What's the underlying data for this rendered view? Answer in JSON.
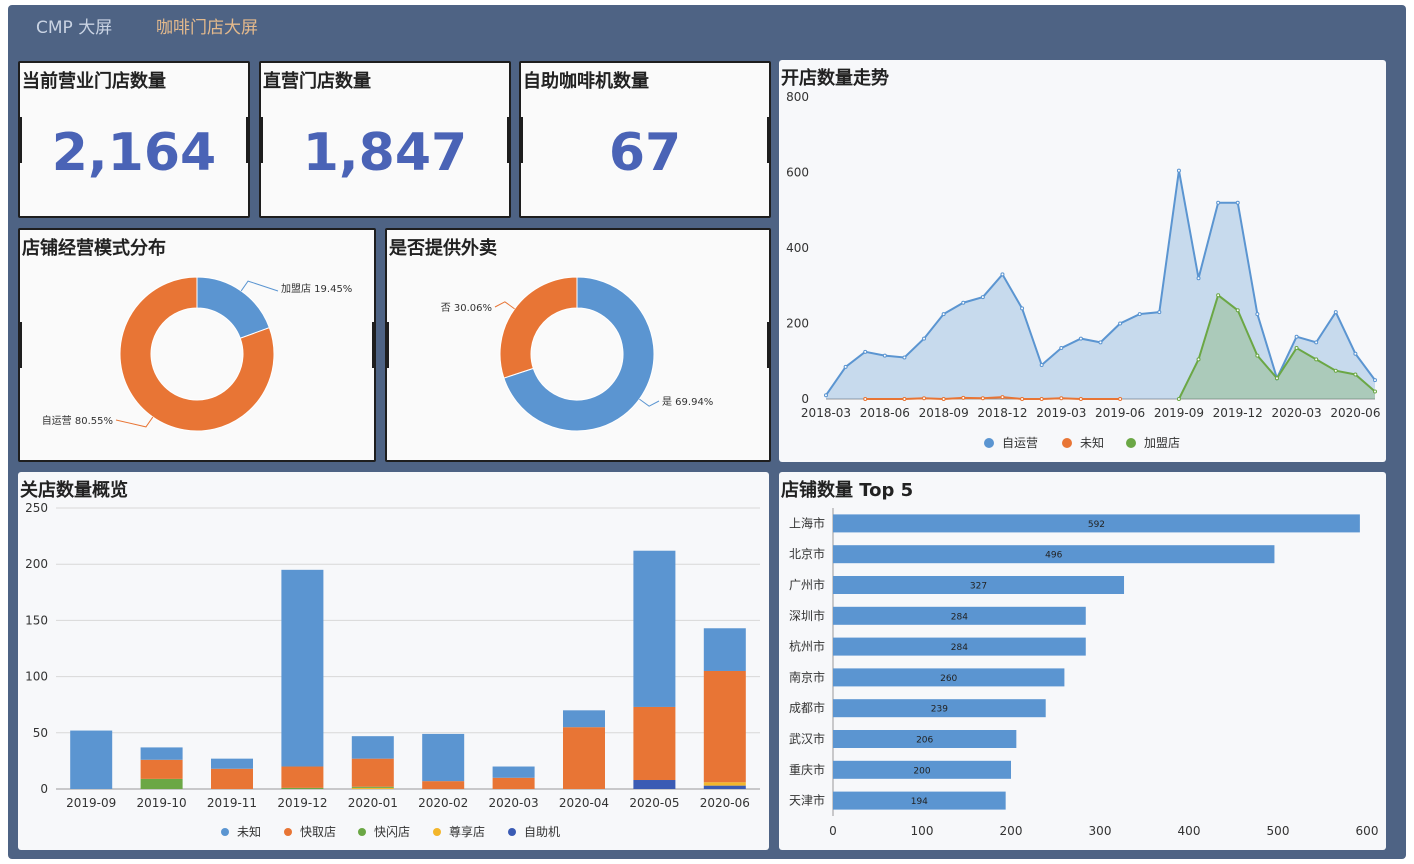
{
  "nav": {
    "cmp": "CMP 大屏",
    "coffee": "咖啡门店大屏"
  },
  "kpis": [
    {
      "title": "当前营业门店数量",
      "value": "2,164"
    },
    {
      "title": "直营门店数量",
      "value": "1,847"
    },
    {
      "title": "自助咖啡机数量",
      "value": "67"
    }
  ],
  "panels": {
    "mode": "店铺经营模式分布",
    "delivery": "是否提供外卖",
    "trend": "开店数量走势",
    "close": "关店数量概览",
    "top": "店铺数量 Top 5"
  },
  "colors": {
    "blue": "#5b95d1",
    "orange": "#e87535",
    "green": "#6ba745",
    "yellow": "#f3b62b",
    "navy": "#3a5bb4"
  },
  "chart_data": [
    {
      "id": "mode",
      "type": "pie",
      "title": "店铺经营模式分布",
      "donut": true,
      "slices": [
        {
          "label": "加盟店",
          "value": 19.45,
          "text": "加盟店 19.45%",
          "color": "#5b95d1"
        },
        {
          "label": "自运营",
          "value": 80.55,
          "text": "自运营 80.55%",
          "color": "#e87535"
        }
      ]
    },
    {
      "id": "delivery",
      "type": "pie",
      "title": "是否提供外卖",
      "donut": true,
      "slices": [
        {
          "label": "是",
          "value": 69.94,
          "text": "是 69.94%",
          "color": "#5b95d1"
        },
        {
          "label": "否",
          "value": 30.06,
          "text": "否 30.06%",
          "color": "#e87535"
        }
      ]
    },
    {
      "id": "trend",
      "type": "area",
      "title": "开店数量走势",
      "ylim": [
        0,
        800
      ],
      "yticks": [
        0,
        200,
        400,
        600,
        800
      ],
      "x": [
        "2018-03",
        "2018-04",
        "2018-05",
        "2018-06",
        "2018-07",
        "2018-08",
        "2018-09",
        "2018-10",
        "2018-11",
        "2018-12",
        "2019-01",
        "2019-02",
        "2019-03",
        "2019-04",
        "2019-05",
        "2019-06",
        "2019-07",
        "2019-08",
        "2019-09",
        "2019-10",
        "2019-11",
        "2019-12",
        "2020-01",
        "2020-02",
        "2020-03",
        "2020-04",
        "2020-05",
        "2020-06",
        "2020-07"
      ],
      "xticks": [
        "2018-03",
        "2018-06",
        "2018-09",
        "2018-12",
        "2019-03",
        "2019-06",
        "2019-09",
        "2019-12",
        "2020-03",
        "2020-06"
      ],
      "legend_position": "bottom",
      "series": [
        {
          "name": "自运营",
          "color": "#5b95d1",
          "values": [
            10,
            85,
            125,
            115,
            110,
            160,
            225,
            255,
            270,
            330,
            240,
            90,
            135,
            160,
            150,
            200,
            225,
            230,
            605,
            320,
            520,
            520,
            225,
            55,
            165,
            150,
            230,
            120,
            50
          ]
        },
        {
          "name": "未知",
          "color": "#e87535",
          "values": [
            null,
            null,
            0,
            null,
            0,
            2,
            0,
            3,
            2,
            5,
            0,
            0,
            2,
            0,
            null,
            0,
            null,
            null,
            null,
            null,
            null,
            null,
            null,
            null,
            null,
            null,
            null,
            null,
            null
          ]
        },
        {
          "name": "加盟店",
          "color": "#6ba745",
          "values": [
            null,
            null,
            null,
            null,
            null,
            null,
            null,
            null,
            null,
            null,
            null,
            null,
            null,
            null,
            null,
            null,
            null,
            null,
            0,
            105,
            275,
            235,
            115,
            55,
            135,
            105,
            75,
            65,
            20
          ]
        }
      ]
    },
    {
      "id": "close",
      "type": "bar",
      "stacked": true,
      "title": "关店数量概览",
      "ylim": [
        0,
        250
      ],
      "yticks": [
        0,
        50,
        100,
        150,
        200,
        250
      ],
      "categories": [
        "2019-09",
        "2019-10",
        "2019-11",
        "2019-12",
        "2020-01",
        "2020-02",
        "2020-03",
        "2020-04",
        "2020-05",
        "2020-06"
      ],
      "legend_position": "bottom",
      "series": [
        {
          "name": "自助机",
          "color": "#3a5bb4",
          "values": [
            0,
            0,
            0,
            0,
            0,
            0,
            0,
            0,
            8,
            3
          ]
        },
        {
          "name": "尊享店",
          "color": "#f3b62b",
          "values": [
            0,
            0,
            0,
            0,
            1,
            0,
            0,
            0,
            0,
            3
          ]
        },
        {
          "name": "快闪店",
          "color": "#6ba745",
          "values": [
            0,
            9,
            0,
            1,
            1,
            0,
            0,
            0,
            0,
            0
          ]
        },
        {
          "name": "快取店",
          "color": "#e87535",
          "values": [
            0,
            17,
            18,
            19,
            25,
            7,
            10,
            55,
            65,
            99
          ]
        },
        {
          "name": "未知",
          "color": "#5b95d1",
          "values": [
            52,
            11,
            9,
            175,
            20,
            42,
            10,
            15,
            139,
            38
          ]
        }
      ],
      "legend_order": [
        "未知",
        "快取店",
        "快闪店",
        "尊享店",
        "自助机"
      ]
    },
    {
      "id": "top",
      "type": "bar",
      "orientation": "horizontal",
      "title": "店铺数量 Top 5",
      "xlim": [
        0,
        600
      ],
      "xticks": [
        0,
        100,
        200,
        300,
        400,
        500,
        600
      ],
      "categories": [
        "上海市",
        "北京市",
        "广州市",
        "深圳市",
        "杭州市",
        "南京市",
        "成都市",
        "武汉市",
        "重庆市",
        "天津市"
      ],
      "values": [
        592,
        496,
        327,
        284,
        284,
        260,
        239,
        206,
        200,
        194
      ],
      "color": "#5b95d1"
    }
  ]
}
